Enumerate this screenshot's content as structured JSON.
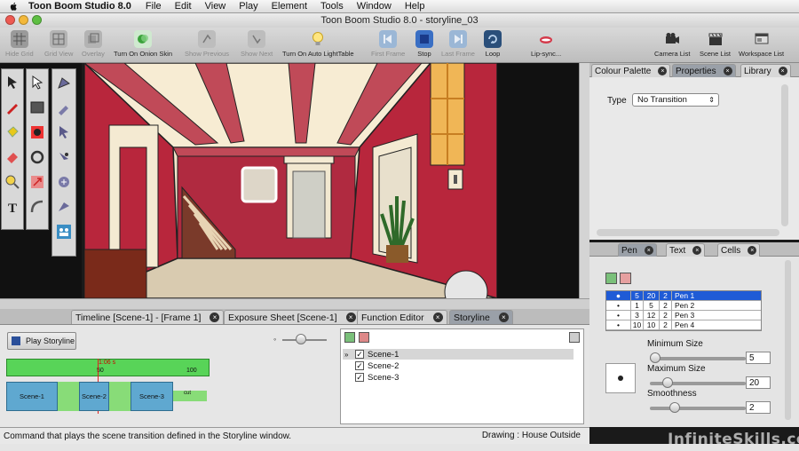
{
  "menubar": {
    "app_name": "Toon Boom Studio 8.0",
    "items": [
      "File",
      "Edit",
      "View",
      "Play",
      "Element",
      "Tools",
      "Window",
      "Help"
    ]
  },
  "window": {
    "title": "Toon Boom Studio 8.0 - storyline_03"
  },
  "toolbar": {
    "buttons": [
      {
        "label": "Hide Grid",
        "icon": "grid-icon",
        "enabled": false
      },
      {
        "label": "Grid View",
        "icon": "grid-view-icon",
        "enabled": false
      },
      {
        "label": "Overlay",
        "icon": "overlay-icon",
        "enabled": false
      },
      {
        "label": "Turn On Onion Skin",
        "icon": "onion-skin-icon",
        "enabled": true
      },
      {
        "label": "Show Previous",
        "icon": "show-previous-icon",
        "enabled": false
      },
      {
        "label": "Show Next",
        "icon": "show-next-icon",
        "enabled": false
      },
      {
        "label": "Turn On Auto LightTable",
        "icon": "lightbulb-icon",
        "enabled": true
      },
      {
        "label": "First Frame",
        "icon": "first-frame-icon",
        "enabled": false
      },
      {
        "label": "Stop",
        "icon": "stop-icon",
        "enabled": true
      },
      {
        "label": "Last Frame",
        "icon": "last-frame-icon",
        "enabled": false
      },
      {
        "label": "Loop",
        "icon": "loop-icon",
        "enabled": true
      },
      {
        "label": "Lip-sync...",
        "icon": "lip-sync-icon",
        "enabled": true
      },
      {
        "label": "Camera List",
        "icon": "camera-icon",
        "enabled": true
      },
      {
        "label": "Scene List",
        "icon": "clapboard-icon",
        "enabled": true
      },
      {
        "label": "Workspace List",
        "icon": "workspace-icon",
        "enabled": true
      }
    ]
  },
  "bottom_tabs": [
    {
      "label": "Timeline [Scene-1] - [Frame 1]",
      "active": false
    },
    {
      "label": "Exposure Sheet [Scene-1]",
      "active": false
    },
    {
      "label": "Function Editor",
      "active": false
    },
    {
      "label": "Storyline",
      "active": true
    }
  ],
  "storyline": {
    "play_label": "Play Storyline",
    "ruler_marks": [
      "50",
      "100"
    ],
    "playhead_label": "1:06 s",
    "scenes": [
      {
        "label": "Scene-1",
        "checked": true,
        "selected": true
      },
      {
        "label": "Scene-2",
        "checked": true,
        "selected": false
      },
      {
        "label": "Scene-3",
        "checked": true,
        "selected": false
      }
    ],
    "trans_end_label": "cut"
  },
  "status": {
    "message": "Command that plays the scene transition defined in the Storyline window.",
    "drawing": "Drawing : House Outside"
  },
  "right_top_tabs": [
    {
      "label": "Colour Palette",
      "active": false
    },
    {
      "label": "Properties",
      "active": true
    },
    {
      "label": "Library",
      "active": false
    }
  ],
  "properties": {
    "type_label": "Type",
    "type_value": "No Transition"
  },
  "right_bottom_tabs": [
    {
      "label": "Pen",
      "active": true
    },
    {
      "label": "Text",
      "active": false
    },
    {
      "label": "Cells",
      "active": false
    }
  ],
  "pens": [
    {
      "c1": "5",
      "c2": "20",
      "c3": "2",
      "name": "Pen 1",
      "selected": true
    },
    {
      "c1": "1",
      "c2": "5",
      "c3": "2",
      "name": "Pen 2",
      "selected": false
    },
    {
      "c1": "3",
      "c2": "12",
      "c3": "2",
      "name": "Pen 3",
      "selected": false
    },
    {
      "c1": "10",
      "c2": "10",
      "c3": "2",
      "name": "Pen 4",
      "selected": false
    }
  ],
  "pen_settings": {
    "min_size_label": "Minimum Size",
    "min_size": "5",
    "max_size_label": "Maximum Size",
    "max_size": "20",
    "smoothness_label": "Smoothness",
    "smoothness": "2"
  },
  "watermark": "InfiniteSkills.com",
  "colors": {
    "accent_selection": "#1f5bd6",
    "wall_red": "#b8263c",
    "scene_block": "#5fa8d0",
    "ruler_green": "#58d458"
  }
}
